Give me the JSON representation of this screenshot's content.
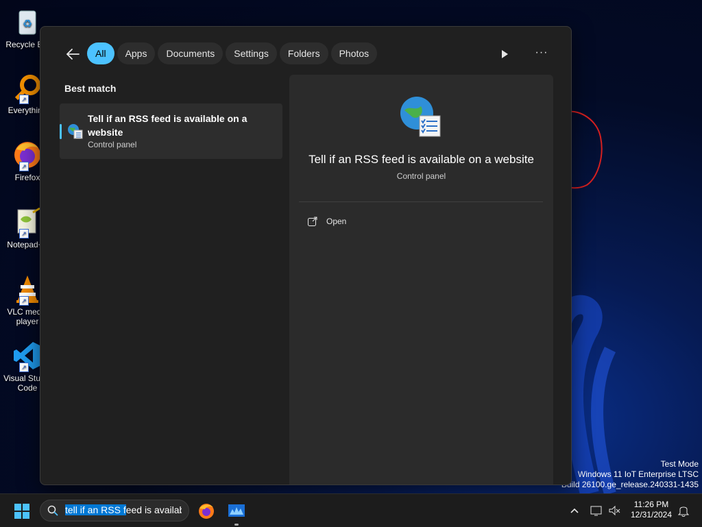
{
  "desktop": {
    "icons": [
      {
        "label": "Recycle Bin",
        "icon": "recycle-bin-icon"
      },
      {
        "label": "Everything",
        "icon": "everything-icon"
      },
      {
        "label": "Firefox",
        "icon": "firefox-icon"
      },
      {
        "label": "Notepad++",
        "icon": "notepadpp-icon"
      },
      {
        "label": "VLC media player",
        "icon": "vlc-icon"
      },
      {
        "label": "Visual Studio Code",
        "icon": "vscode-icon"
      }
    ],
    "watermark": {
      "line1": "Test Mode",
      "line2": "Windows 11 IoT Enterprise LTSC",
      "line3": "Build 26100.ge_release.240331-1435"
    }
  },
  "search_panel": {
    "filters": [
      {
        "label": "All",
        "active": true
      },
      {
        "label": "Apps"
      },
      {
        "label": "Documents"
      },
      {
        "label": "Settings"
      },
      {
        "label": "Folders"
      },
      {
        "label": "Photos"
      }
    ],
    "best_match_label": "Best match",
    "result": {
      "title": "Tell if an RSS feed is available on a website",
      "subtitle": "Control panel"
    },
    "preview": {
      "title": "Tell if an RSS feed is available on a website",
      "subtitle": "Control panel",
      "actions": [
        {
          "label": "Open",
          "icon": "open-external-icon"
        }
      ]
    }
  },
  "taskbar": {
    "search_value": "tell if an RSS feed is available on a website",
    "search_selected": "tell if an RSS f",
    "search_rest": "eed is availab",
    "clock_time": "11:26 PM",
    "clock_date": "12/31/2024",
    "accent_color": "#4cc2ff"
  }
}
